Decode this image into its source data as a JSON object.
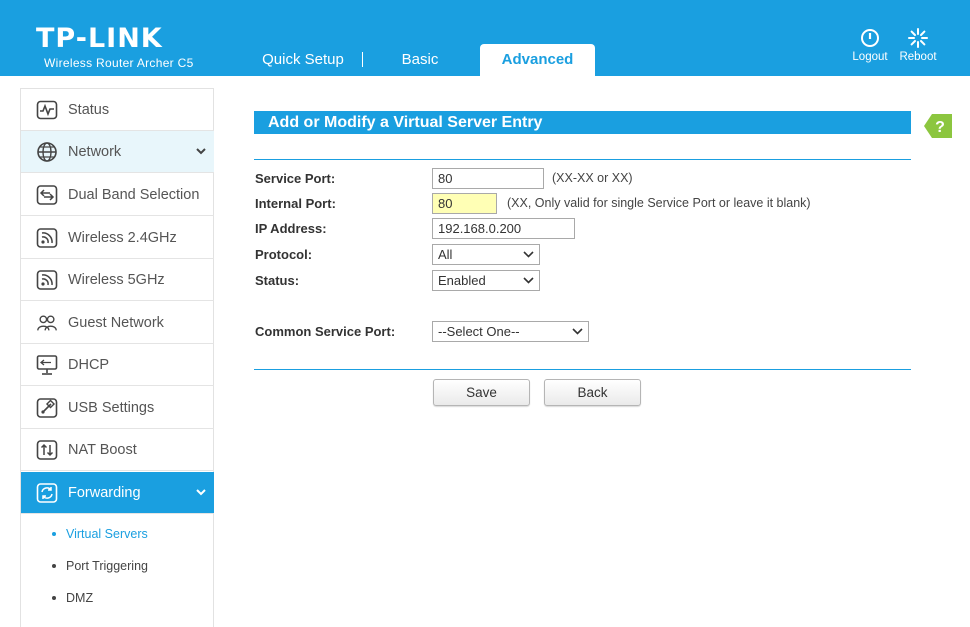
{
  "header": {
    "logo": "TP-LINK",
    "model": "Wireless Router Archer C5",
    "tabs": [
      {
        "label": "Quick Setup"
      },
      {
        "label": "Basic"
      },
      {
        "label": "Advanced"
      }
    ],
    "logout_label": "Logout",
    "reboot_label": "Reboot"
  },
  "sidebar": {
    "items": [
      {
        "label": "Status",
        "icon": "status-icon"
      },
      {
        "label": "Network",
        "icon": "globe-icon"
      },
      {
        "label": "Dual Band Selection",
        "icon": "dual-band-icon"
      },
      {
        "label": "Wireless 2.4GHz",
        "icon": "wireless-icon"
      },
      {
        "label": "Wireless 5GHz",
        "icon": "wireless-icon"
      },
      {
        "label": "Guest Network",
        "icon": "guest-icon"
      },
      {
        "label": "DHCP",
        "icon": "dhcp-icon"
      },
      {
        "label": "USB Settings",
        "icon": "usb-icon"
      },
      {
        "label": "NAT Boost",
        "icon": "nat-boost-icon"
      },
      {
        "label": "Forwarding",
        "icon": "forwarding-icon"
      }
    ],
    "sub_items": [
      {
        "label": "Virtual Servers"
      },
      {
        "label": "Port Triggering"
      },
      {
        "label": "DMZ"
      }
    ]
  },
  "form": {
    "title": "Add or Modify a Virtual Server Entry",
    "service_port_label": "Service Port:",
    "service_port_value": "80",
    "service_port_hint": "(XX-XX or XX)",
    "internal_port_label": "Internal Port:",
    "internal_port_value": "80",
    "internal_port_hint": "(XX, Only valid for single Service Port or leave it blank)",
    "ip_label": "IP Address:",
    "ip_value": "192.168.0.200",
    "protocol_label": "Protocol:",
    "protocol_value": "All",
    "status_label": "Status:",
    "status_value": "Enabled",
    "common_port_label": "Common Service Port:",
    "common_port_value": "--Select One--",
    "save_label": "Save",
    "back_label": "Back"
  },
  "colors": {
    "brand": "#1a9fe0",
    "help": "#8cc63f",
    "highlight_field": "#ffffb5"
  }
}
